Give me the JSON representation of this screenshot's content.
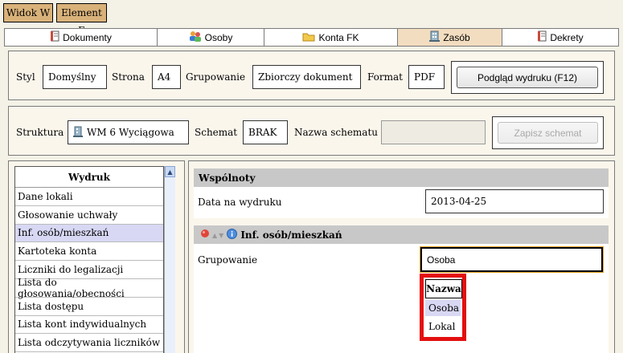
{
  "top_buttons": [
    {
      "label": "Widok W"
    },
    {
      "label": "Element E"
    }
  ],
  "tabs": [
    {
      "label": "Dokumenty",
      "icon": "document-icon"
    },
    {
      "label": "Osoby",
      "icon": "people-icon"
    },
    {
      "label": "Konta FK",
      "icon": "folder-icon"
    },
    {
      "label": "Zasób",
      "icon": "building-icon",
      "active": true
    },
    {
      "label": "Dekrety",
      "icon": "document-icon"
    }
  ],
  "print_options": {
    "style_label": "Styl",
    "style_value": "Domyślny",
    "page_label": "Strona",
    "page_value": "A4",
    "grouping_label": "Grupowanie",
    "grouping_value": "Zbiorczy dokument",
    "format_label": "Format",
    "format_value": "PDF",
    "preview_button": "Podgląd wydruku (F12)"
  },
  "structure": {
    "structure_label": "Struktura",
    "structure_value": "WM 6 Wyciągowa",
    "schema_label": "Schemat",
    "schema_value": "BRAK",
    "schema_name_label": "Nazwa schematu",
    "schema_name_value": "",
    "save_button": "Zapisz schemat"
  },
  "printout_list": {
    "header": "Wydruk",
    "items": [
      "Dane lokali",
      "Głosowanie uchwały",
      "Inf. osób/mieszkań",
      "Kartoteka konta",
      "Liczniki do legalizacji",
      "Lista do głosowania/obecności",
      "Lista dostępu",
      "Lista kont indywidualnych",
      "Lista odczytywania liczników"
    ],
    "selected_index": 2
  },
  "common": {
    "header": "Wspólnoty",
    "date_label": "Data na wydruku",
    "date_value": "2013-04-25"
  },
  "info": {
    "header": "Inf. osób/mieszkań",
    "grouping_label": "Grupowanie",
    "grouping_value": "Osoba"
  },
  "dropdown": {
    "header": "Nazwa",
    "options": [
      "Osoba",
      "Lokal"
    ],
    "selected_index": 0
  },
  "colors": {
    "accent_tab": "#f3ddc0",
    "highlight_border": "#e30f0f",
    "selection": "#d8d8f4"
  }
}
